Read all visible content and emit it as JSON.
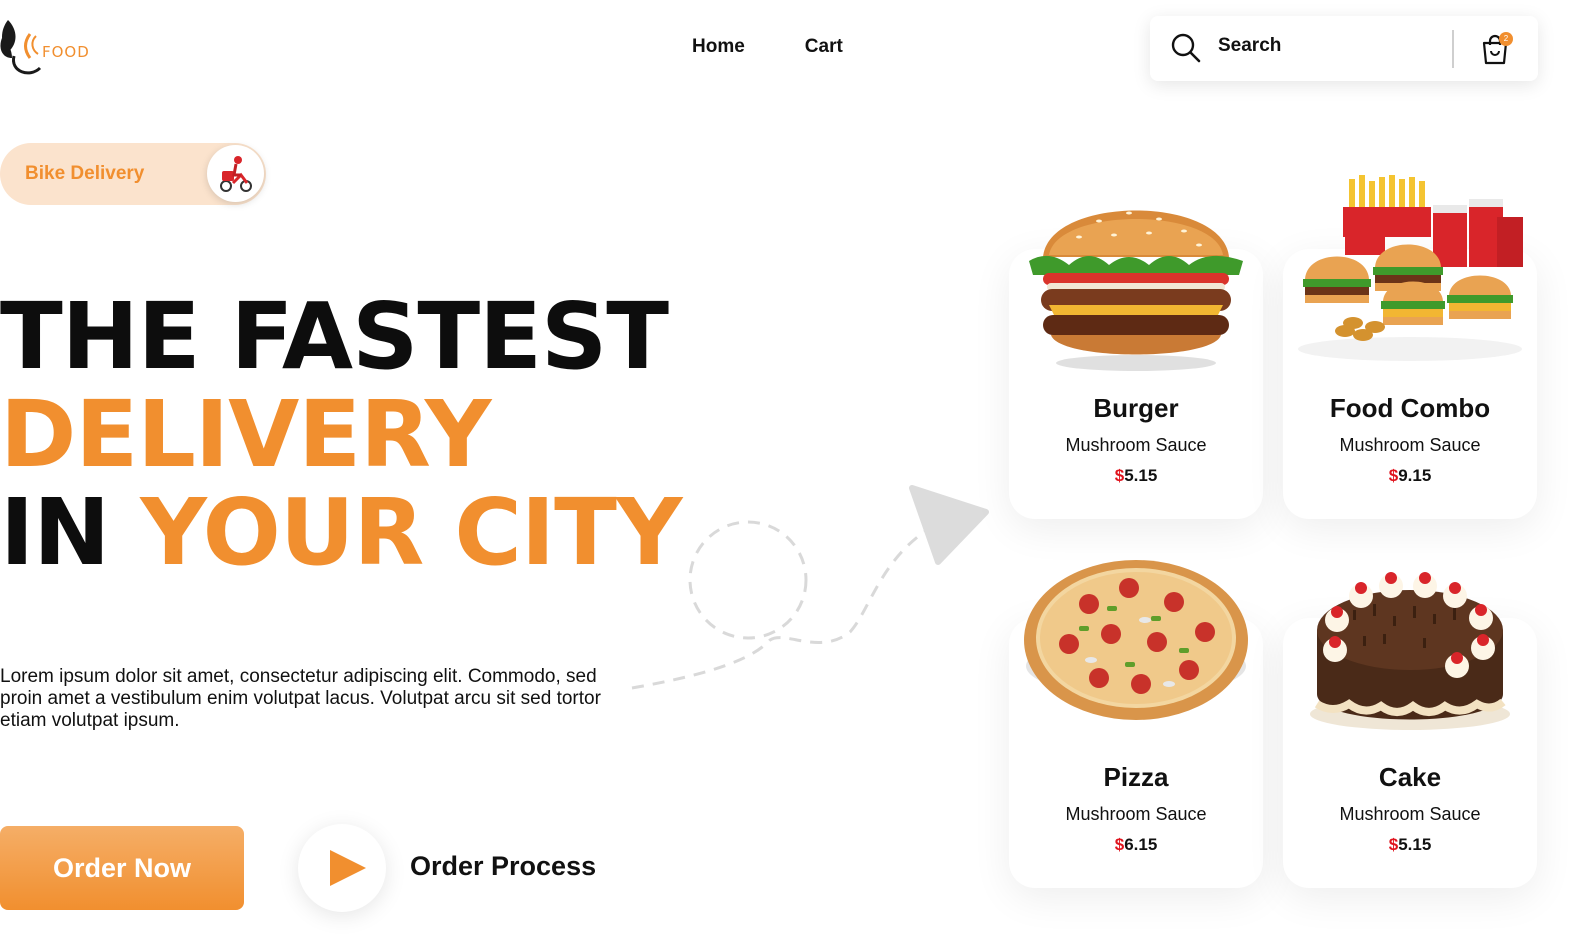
{
  "brand": {
    "logo_text": "FOOD",
    "accent_color": "#f18f2f",
    "price_currency_color": "#e0141e"
  },
  "nav": {
    "items": [
      {
        "label": "Home"
      },
      {
        "label": "Cart"
      }
    ]
  },
  "search": {
    "placeholder": "Search",
    "icon": "search-icon",
    "cart_icon": "shopping-bag-icon",
    "cart_count": "2"
  },
  "hero": {
    "badge_label": "Bike Delivery",
    "badge_icon": "delivery-rider-icon",
    "headline_line1": "THE FASTEST",
    "headline_line2": "DELIVERY",
    "headline_line3a": "IN ",
    "headline_line3b": "YOUR CITY",
    "description": "Lorem ipsum dolor sit amet, consectetur adipiscing elit. Commodo, sed proin amet a vestibulum enim volutpat lacus. Volutpat arcu sit sed tortor etiam volutpat ipsum.",
    "order_button": "Order Now",
    "process_label": "Order Process",
    "play_icon": "play-icon"
  },
  "menu": {
    "items": [
      {
        "name": "Burger",
        "subtitle": "Mushroom Sauce",
        "currency": "$",
        "price": "5.15",
        "image": "burger-image"
      },
      {
        "name": "Food Combo",
        "subtitle": "Mushroom Sauce",
        "currency": "$",
        "price": "9.15",
        "image": "food-combo-image"
      },
      {
        "name": "Pizza",
        "subtitle": "Mushroom Sauce",
        "currency": "$",
        "price": "6.15",
        "image": "pizza-image"
      },
      {
        "name": "Cake",
        "subtitle": "Mushroom Sauce",
        "currency": "$",
        "price": "5.15",
        "image": "cake-image"
      }
    ]
  }
}
